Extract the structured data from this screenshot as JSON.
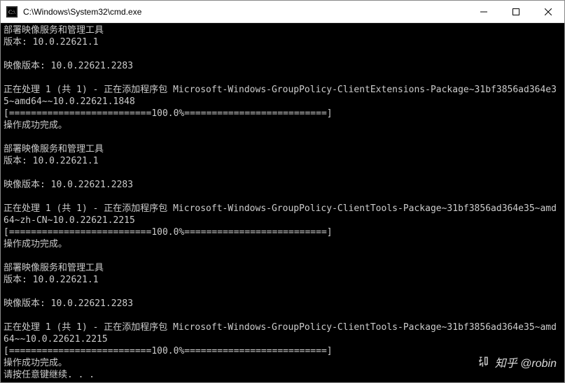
{
  "title_bar": {
    "path": "C:\\Windows\\System32\\cmd.exe"
  },
  "console": {
    "lines": [
      "部署映像服务和管理工具",
      "版本: 10.0.22621.1",
      "",
      "映像版本: 10.0.22621.2283",
      "",
      "正在处理 1 (共 1) - 正在添加程序包 Microsoft-Windows-GroupPolicy-ClientExtensions-Package~31bf3856ad364e35~amd64~~10.0.22621.1848",
      "[==========================100.0%==========================]",
      "操作成功完成。",
      "",
      "部署映像服务和管理工具",
      "版本: 10.0.22621.1",
      "",
      "映像版本: 10.0.22621.2283",
      "",
      "正在处理 1 (共 1) - 正在添加程序包 Microsoft-Windows-GroupPolicy-ClientTools-Package~31bf3856ad364e35~amd64~zh-CN~10.0.22621.2215",
      "[==========================100.0%==========================]",
      "操作成功完成。",
      "",
      "部署映像服务和管理工具",
      "版本: 10.0.22621.1",
      "",
      "映像版本: 10.0.22621.2283",
      "",
      "正在处理 1 (共 1) - 正在添加程序包 Microsoft-Windows-GroupPolicy-ClientTools-Package~31bf3856ad364e35~amd64~~10.0.22621.2215",
      "[==========================100.0%==========================]",
      "操作成功完成。",
      "请按任意键继续. . ."
    ]
  },
  "watermark": {
    "text": "知乎 @robin"
  }
}
